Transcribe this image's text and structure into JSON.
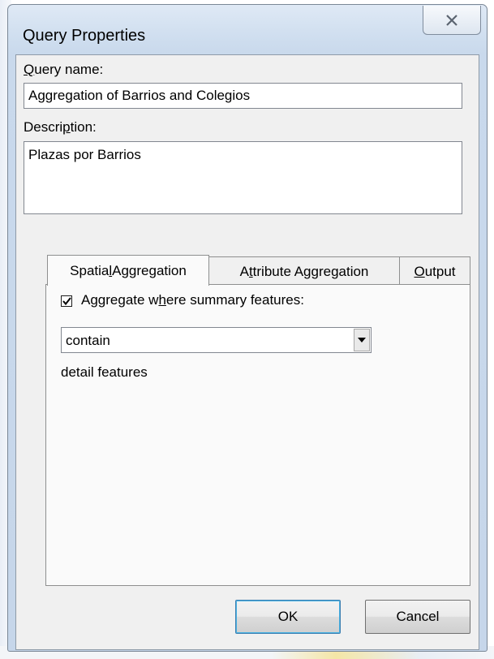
{
  "window": {
    "title": "Query Properties",
    "close_icon": "close-icon"
  },
  "query_name": {
    "label_accel": "Q",
    "label_rest": "uery name:",
    "value": "Aggregation of Barrios and Colegios"
  },
  "description": {
    "label_before": "Descri",
    "label_accel": "p",
    "label_after": "tion:",
    "value": "Plazas por Barrios"
  },
  "tabs": [
    {
      "before": "Spatia",
      "accel": "l",
      "after": " Aggregation",
      "active": true
    },
    {
      "before": "A",
      "accel": "t",
      "after": "tribute Aggregation",
      "active": false
    },
    {
      "before": "",
      "accel": "O",
      "after": "utput",
      "active": false
    }
  ],
  "spatial": {
    "checkbox_checked": true,
    "checkbox_label_before": "Aggregate w",
    "checkbox_label_accel": "h",
    "checkbox_label_after": "ere summary features:",
    "relation_value": "contain",
    "detail_text": "detail features"
  },
  "buttons": {
    "ok": "OK",
    "cancel": "Cancel"
  },
  "colors": {
    "title_bar": "#cfdeef",
    "dialog_face": "#f0f0f0",
    "tab_page": "#fafafa"
  }
}
